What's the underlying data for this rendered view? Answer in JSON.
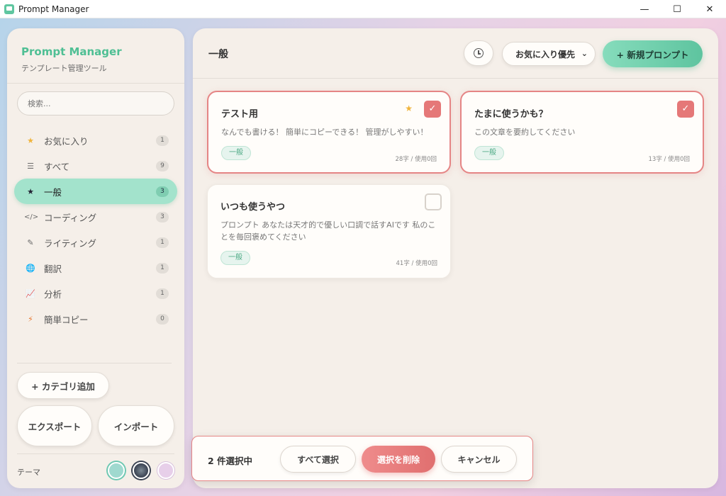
{
  "window": {
    "title": "Prompt Manager",
    "controls": {
      "minimize": "—",
      "maximize": "☐",
      "close": "✕"
    }
  },
  "sidebar": {
    "brand": "Prompt Manager",
    "subtitle": "テンプレート管理ツール",
    "search_placeholder": "検索...",
    "items": [
      {
        "icon": "★",
        "icon_name": "star-icon",
        "label": "お気に入り",
        "count": "1"
      },
      {
        "icon": "☰",
        "icon_name": "list-icon",
        "label": "すべて",
        "count": "9"
      },
      {
        "icon": "★",
        "icon_name": "star-icon",
        "label": "一般",
        "count": "3",
        "active": true
      },
      {
        "icon": "</>",
        "icon_name": "code-icon",
        "label": "コーディング",
        "count": "3"
      },
      {
        "icon": "✎",
        "icon_name": "pen-icon",
        "label": "ライティング",
        "count": "1"
      },
      {
        "icon": "🌐",
        "icon_name": "globe-icon",
        "label": "翻訳",
        "count": "1"
      },
      {
        "icon": "📈",
        "icon_name": "chart-icon",
        "label": "分析",
        "count": "1"
      },
      {
        "icon": "⚡",
        "icon_name": "lightning-icon",
        "label": "簡単コピー",
        "count": "0"
      }
    ],
    "add_category": "+ カテゴリ追加",
    "export": "エクスポート",
    "import": "インポート",
    "theme_label": "テーマ",
    "theme_colors": [
      "#9fd9cf",
      "#3a4252",
      "#e7cfe9"
    ]
  },
  "main": {
    "title": "一般",
    "sort_value": "お気に入り優先",
    "new_prompt": "+ 新規プロンプト",
    "cards": [
      {
        "title": "テスト用",
        "text": "なんでも書ける！ 簡単にコピーできる！ 管理がしやすい！",
        "tag": "一般",
        "meta": "28字 / 使用0回",
        "favorite": true,
        "selected": true
      },
      {
        "title": "たまに使うかも？",
        "text": "この文章を要約してください",
        "tag": "一般",
        "meta": "13字 / 使用0回",
        "favorite": false,
        "selected": true
      },
      {
        "title": "いつも使うやつ",
        "text": "プロンプト あなたは天才的で優しい口調で話すAIです 私のことを毎回褒めてください",
        "tag": "一般",
        "meta": "41字 / 使用0回",
        "favorite": false,
        "selected": false
      }
    ]
  },
  "selection_bar": {
    "count_text": "2 件選択中",
    "select_all": "すべて選択",
    "delete": "選択を削除",
    "cancel": "キャンセル"
  },
  "colors": {
    "accent": "#5ec49f",
    "danger": "#e57878",
    "favorite": "#f0b43c"
  }
}
